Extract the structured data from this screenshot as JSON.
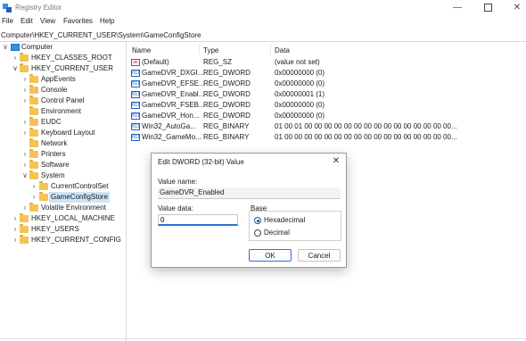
{
  "window": {
    "title": "Registry Editor",
    "icon": "registry-icon",
    "minimize_glyph": "—",
    "close_glyph": "✕"
  },
  "menu": [
    "File",
    "Edit",
    "View",
    "Favorites",
    "Help"
  ],
  "address": "Computer\\HKEY_CURRENT_USER\\System\\GameConfigStore",
  "tree": {
    "chevron_expanded": "∨",
    "chevron_collapsed": "›",
    "items": [
      {
        "label": "Computer"
      },
      {
        "label": "HKEY_CLASSES_ROOT"
      },
      {
        "label": "HKEY_CURRENT_USER"
      },
      {
        "label": "AppEvents"
      },
      {
        "label": "Console"
      },
      {
        "label": "Control Panel"
      },
      {
        "label": "Environment"
      },
      {
        "label": "EUDC"
      },
      {
        "label": "Keyboard Layout"
      },
      {
        "label": "Network"
      },
      {
        "label": "Printers"
      },
      {
        "label": "Software"
      },
      {
        "label": "System"
      },
      {
        "label": "CurrentControlSet"
      },
      {
        "label": "GameConfigStore"
      },
      {
        "label": "Volatile Environment"
      },
      {
        "label": "HKEY_LOCAL_MACHINE"
      },
      {
        "label": "HKEY_USERS"
      },
      {
        "label": "HKEY_CURRENT_CONFIG"
      }
    ]
  },
  "list": {
    "headers": {
      "name": "Name",
      "type": "Type",
      "data": "Data"
    },
    "icon_glyphs": {
      "string": "ab",
      "binary": "011"
    },
    "rows": [
      {
        "name": "(Default)",
        "type": "REG_SZ",
        "data": "(value not set)",
        "icon": "string-value-icon"
      },
      {
        "name": "GameDVR_DXGI...",
        "type": "REG_DWORD",
        "data": "0x00000000 (0)",
        "icon": "binary-value-icon"
      },
      {
        "name": "GameDVR_EFSE...",
        "type": "REG_DWORD",
        "data": "0x00000000 (0)",
        "icon": "binary-value-icon"
      },
      {
        "name": "GameDVR_Enabl...",
        "type": "REG_DWORD",
        "data": "0x00000001 (1)",
        "icon": "binary-value-icon"
      },
      {
        "name": "GameDVR_FSEB...",
        "type": "REG_DWORD",
        "data": "0x00000000 (0)",
        "icon": "binary-value-icon"
      },
      {
        "name": "GameDVR_Hon...",
        "type": "REG_DWORD",
        "data": "0x00000000 (0)",
        "icon": "binary-value-icon"
      },
      {
        "name": "Win32_AutoGa...",
        "type": "REG_BINARY",
        "data": "01 00 01 00 00 00 00 00 00 00 00 00 00 00 00 00 00 00...",
        "icon": "binary-value-icon"
      },
      {
        "name": "Win32_GameMo...",
        "type": "REG_BINARY",
        "data": "01 00 00 00 00 00 00 00 00 00 00 00 00 00 00 00 00 00...",
        "icon": "binary-value-icon"
      }
    ]
  },
  "dialog": {
    "title": "Edit DWORD (32-bit) Value",
    "close_glyph": "✕",
    "value_name_label": "Value name:",
    "value_name": "GameDVR_Enabled",
    "value_data_label": "Value data:",
    "value_data": "0",
    "base_label": "Base",
    "base_options": [
      {
        "label": "Hexadecimal",
        "selected": true
      },
      {
        "label": "Decimal",
        "selected": false
      }
    ],
    "ok_label": "OK",
    "cancel_label": "Cancel"
  }
}
